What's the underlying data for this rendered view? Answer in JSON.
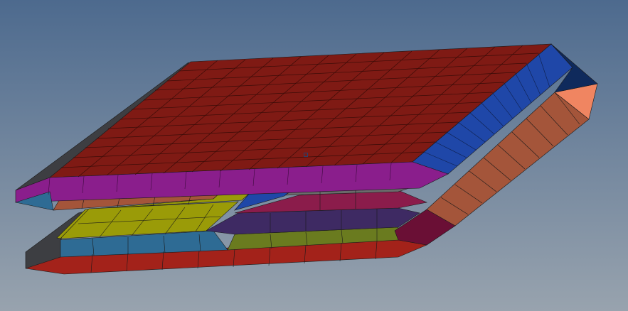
{
  "viewport": {
    "background_top": "#4d6a8e",
    "background_bottom": "#98a3ae",
    "mesh_line_color": "#1a1a1a"
  },
  "model": {
    "description_colors": {
      "top_plate": "#7f1a14",
      "top_side_strip": "#1f47a8",
      "top_front_edge": "#8a1e8c",
      "orange_face": "#f08561",
      "orange_side": "#a4553a",
      "dark_side": "#3d3e42",
      "steel_blue": "#2e6b94",
      "olive": "#9a9b08",
      "magenta": "#8b1c4b",
      "purple_dark": "#3e2a63",
      "gray": "#6b6b6b",
      "bottom_red": "#a3221a",
      "green_olive": "#6a7b1f"
    }
  }
}
